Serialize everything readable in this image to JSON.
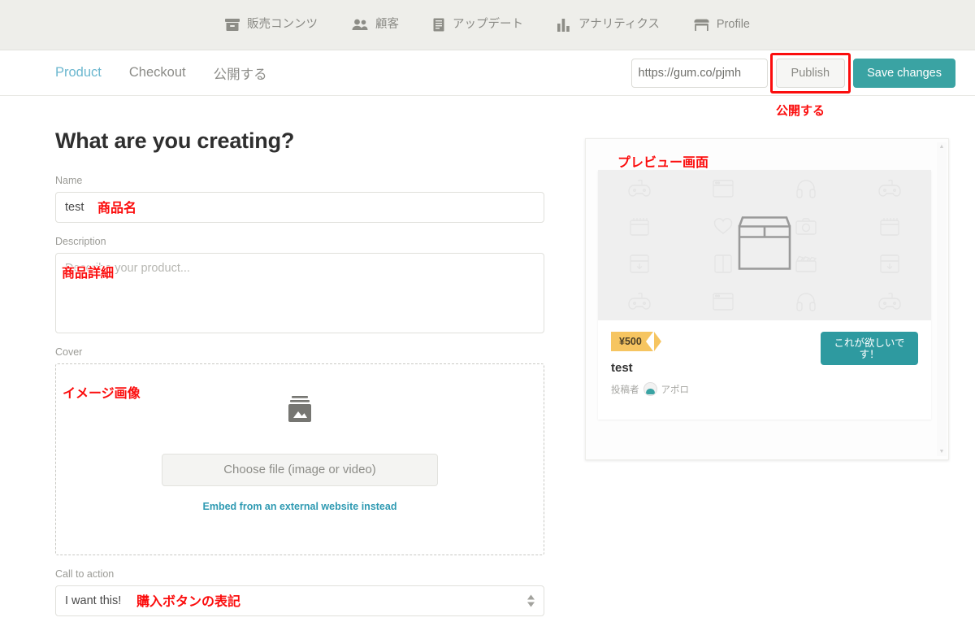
{
  "topnav": {
    "items": [
      {
        "icon": "archive-box-icon",
        "label": "販売コンンツ"
      },
      {
        "icon": "people-icon",
        "label": "顧客"
      },
      {
        "icon": "document-icon",
        "label": "アップデート"
      },
      {
        "icon": "bar-chart-icon",
        "label": "アナリティクス"
      },
      {
        "icon": "storefront-icon",
        "label": "Profile"
      }
    ]
  },
  "subheader": {
    "tabs": [
      {
        "label": "Product",
        "active": true
      },
      {
        "label": "Checkout",
        "active": false
      },
      {
        "label": "公開する",
        "active": false
      }
    ],
    "url_value": "https://gum.co/pjmh",
    "publish_label": "Publish",
    "save_label": "Save changes",
    "publish_annotation": "公開する"
  },
  "form": {
    "heading": "What are you creating?",
    "name": {
      "label": "Name",
      "value": "test",
      "annotation": "商品名"
    },
    "description": {
      "label": "Description",
      "placeholder": "Describe your product...",
      "annotation": "商品詳細"
    },
    "cover": {
      "label": "Cover",
      "annotation": "イメージ画像",
      "icon": "image-upload-icon",
      "choose_label": "Choose file (image or video)",
      "embed_label": "Embed from an external website instead"
    },
    "call_to_action": {
      "label": "Call to action",
      "value": "I want this!",
      "annotation": "購入ボタンの表記"
    }
  },
  "preview": {
    "annotation": "プレビュー画面",
    "cover_icon": "package-box-icon",
    "pattern_icons": [
      "gamepad-icon",
      "window-icon",
      "headphones-icon",
      "gamepad-icon",
      "calendar-icon",
      "heart-icon",
      "camera-icon",
      "calendar-icon",
      "download-box-icon",
      "book-icon",
      "clapperboard-icon",
      "download-box-icon",
      "gamepad-icon",
      "window-icon",
      "headphones-icon",
      "gamepad-icon"
    ],
    "price": "¥500",
    "title": "test",
    "author_prefix": "投稿者",
    "author_name": "アポロ",
    "buy_button_label": "これが欲しいです！"
  },
  "colors": {
    "teal": "#3aa3a3",
    "teal_button": "#2e9aa0",
    "tab_active": "#6bb7cf",
    "link": "#2f9ab2",
    "annotation_red": "#fb0d0d",
    "price_yellow": "#f6c561",
    "topnav_bg": "#eeeeea"
  }
}
